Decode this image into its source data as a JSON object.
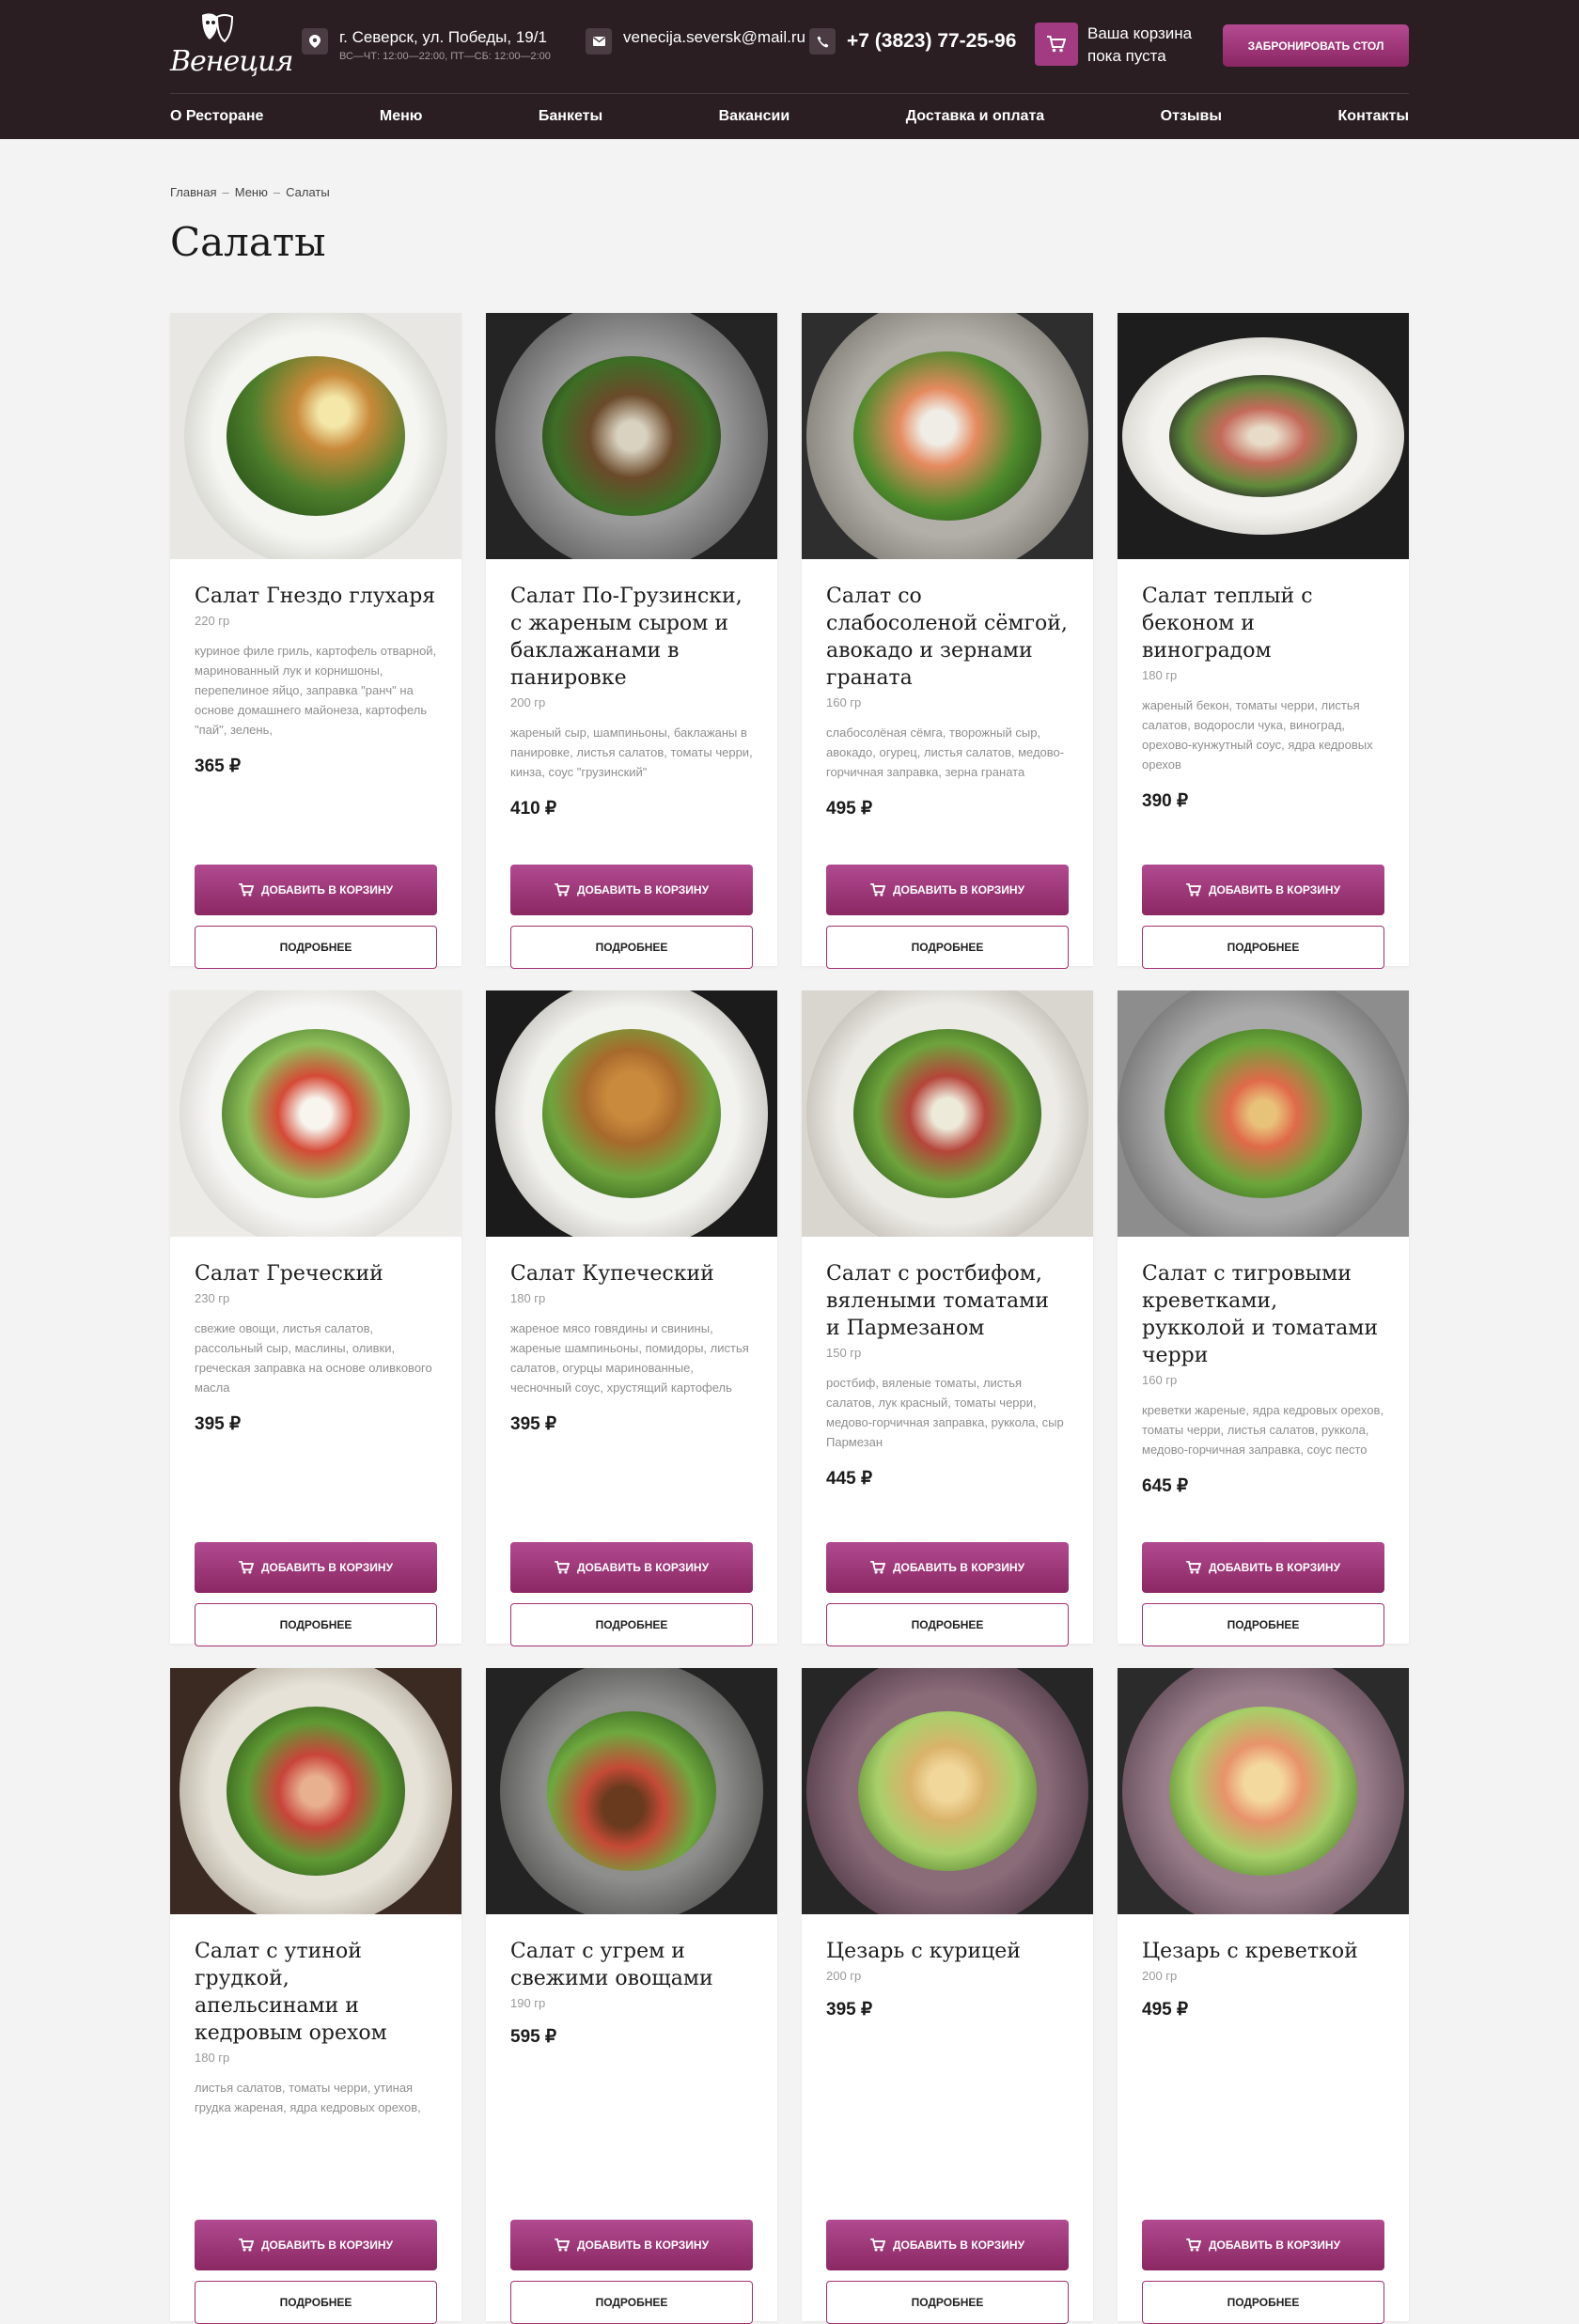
{
  "header": {
    "logo_text": "Венеция",
    "address": "г. Северск, ул. Победы, 19/1",
    "hours": "ВС—ЧТ: 12:00—22:00, ПТ—СБ: 12:00—2:00",
    "email": "venecija.seversk@mail.ru",
    "phone": "+7 (3823) 77-25-96",
    "cart_line1": "Ваша корзина",
    "cart_line2": "пока пуста",
    "book_button": "ЗАБРОНИРОВАТЬ СТОЛ",
    "icons": [
      "map-pin-icon",
      "mail-icon",
      "phone-icon",
      "cart-icon"
    ],
    "accent_color": "#a23b81",
    "header_bg": "#2a1e23"
  },
  "nav": {
    "items": [
      "О Ресторане",
      "Меню",
      "Банкеты",
      "Вакансии",
      "Доставка и оплата",
      "Отзывы",
      "Контакты"
    ]
  },
  "breadcrumbs": [
    "Главная",
    "Меню",
    "Салаты"
  ],
  "breadcrumb_sep": "–",
  "page_title": "Салаты",
  "buttons": {
    "add": "ДОБАВИТЬ В КОРЗИНУ",
    "more": "ПОДРОБНЕЕ"
  },
  "products": [
    {
      "name": "Салат Гнездо глухаря",
      "weight": "220 гр",
      "desc": "куриное филе гриль, картофель отварной, маринованный лук и корнишоны, перепелиное яйцо, заправка \"ранч\" на основе домашнего майонеза, картофель \"пай\", зелень,",
      "price": "365 ₽"
    },
    {
      "name": "Салат По-Грузински, с жареным сыром и баклажанами в панировке",
      "weight": "200 гр",
      "desc": "жареный сыр, шампиньоны, баклажаны в панировке, листья салатов, томаты черри, кинза, соус \"грузинский\"",
      "price": "410 ₽"
    },
    {
      "name": "Салат со слабосоленой сёмгой, авокадо и зернами граната",
      "weight": "160 гр",
      "desc": "слабосолёная сёмга, творожный сыр, авокадо, огурец, листья салатов, медово-горчичная заправка, зерна граната",
      "price": "495 ₽"
    },
    {
      "name": "Салат теплый с беконом и виноградом",
      "weight": "180 гр",
      "desc": "жареный бекон, томаты черри, листья салатов, водоросли чука, виноград, орехово-кунжутный соус, ядра кедровых орехов",
      "price": "390 ₽"
    },
    {
      "name": "Салат Греческий",
      "weight": "230 гр",
      "desc": "свежие овощи, листья салатов, рассольный сыр, маслины, оливки, греческая заправка на основе оливкового масла",
      "price": "395 ₽"
    },
    {
      "name": "Салат Купеческий",
      "weight": "180 гр",
      "desc": "жареное мясо говядины и свинины, жареные шампиньоны, помидоры, листья салатов, огурцы маринованные, чесночный соус, хрустящий картофель",
      "price": "395 ₽"
    },
    {
      "name": "Салат с ростбифом, вялеными томатами и Пармезаном",
      "weight": "150 гр",
      "desc": "ростбиф, вяленые томаты, листья салатов, лук красный, томаты черри, медово-горчичная заправка, руккола, сыр Пармезан",
      "price": "445 ₽"
    },
    {
      "name": "Салат с тигровыми креветками, рукколой и томатами черри",
      "weight": "160 гр",
      "desc": "креветки жареные, ядра кедровых орехов, томаты черри, листья салатов, руккола, медово-горчичная заправка, соус песто",
      "price": "645 ₽"
    },
    {
      "name": "Салат с утиной грудкой, апельсинами и кедровым орехом",
      "weight": "180 гр",
      "desc": "листья салатов, томаты черри, утиная грудка жареная, ядра кедровых орехов,",
      "price": ""
    },
    {
      "name": "Салат с угрем и свежими овощами",
      "weight": "190 гр",
      "desc": "",
      "price": "595 ₽"
    },
    {
      "name": "Цезарь с курицей",
      "weight": "200 гр",
      "desc": "",
      "price": "395 ₽"
    },
    {
      "name": "Цезарь с креветкой",
      "weight": "200 гр",
      "desc": "",
      "price": "495 ₽"
    }
  ]
}
